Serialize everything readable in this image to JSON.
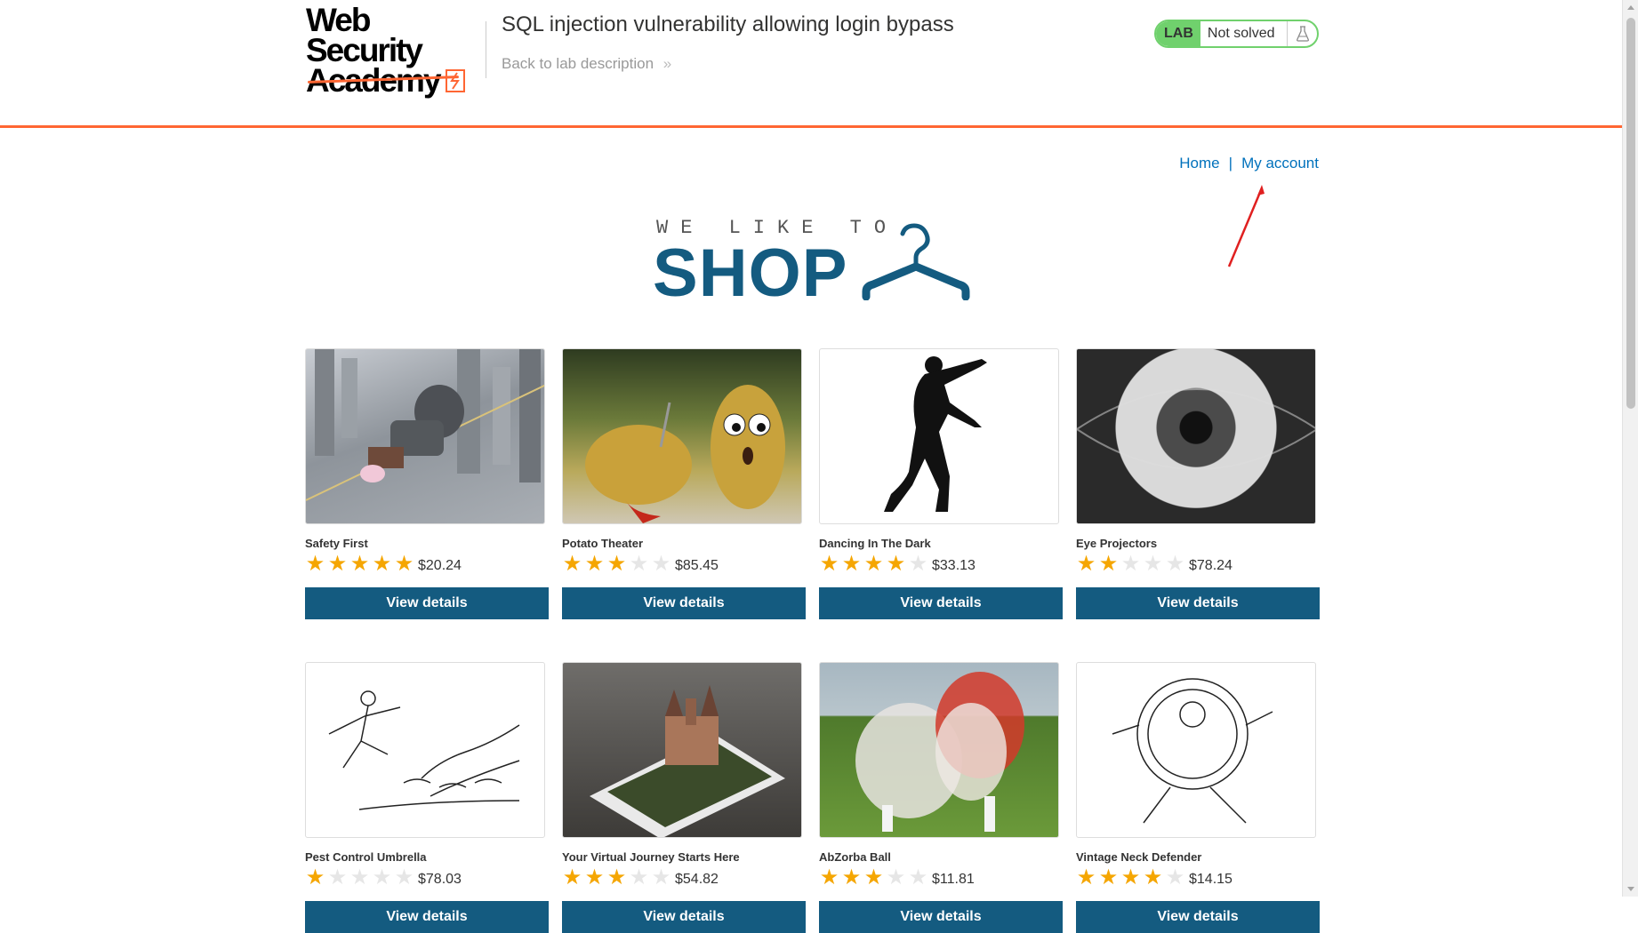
{
  "header": {
    "logo_line1": "Web Security",
    "logo_line2": "Academy",
    "lab_title": "SQL injection vulnerability allowing login bypass",
    "back_link": "Back to lab description",
    "lab_badge": "LAB",
    "lab_status": "Not solved"
  },
  "nav": {
    "home": "Home",
    "separator": "|",
    "my_account": "My account"
  },
  "banner": {
    "small": "WE LIKE TO",
    "big": "SHOP"
  },
  "colors": {
    "accent_orange": "#ff6633",
    "brand_blue": "#145b80",
    "link_blue": "#0071bc",
    "star_gold": "#f5a602",
    "lab_green": "#70d16d",
    "annotation_red": "#e02020"
  },
  "products": [
    {
      "name": "Safety First",
      "rating": 5,
      "price": "$20.24",
      "button": "View details",
      "image": "safety-first-image"
    },
    {
      "name": "Potato Theater",
      "rating": 3,
      "price": "$85.45",
      "button": "View details",
      "image": "potato-theater-image"
    },
    {
      "name": "Dancing In The Dark",
      "rating": 4,
      "price": "$33.13",
      "button": "View details",
      "image": "dancing-in-the-dark-image"
    },
    {
      "name": "Eye Projectors",
      "rating": 2,
      "price": "$78.24",
      "button": "View details",
      "image": "eye-projectors-image"
    },
    {
      "name": "Pest Control Umbrella",
      "rating": 1,
      "price": "$78.03",
      "button": "View details",
      "image": "pest-control-umbrella-image"
    },
    {
      "name": "Your Virtual Journey Starts Here",
      "rating": 3,
      "price": "$54.82",
      "button": "View details",
      "image": "virtual-journey-image"
    },
    {
      "name": "AbZorba Ball",
      "rating": 3,
      "price": "$11.81",
      "button": "View details",
      "image": "abzorba-ball-image"
    },
    {
      "name": "Vintage Neck Defender",
      "rating": 4,
      "price": "$14.15",
      "button": "View details",
      "image": "vintage-neck-defender-image"
    }
  ]
}
